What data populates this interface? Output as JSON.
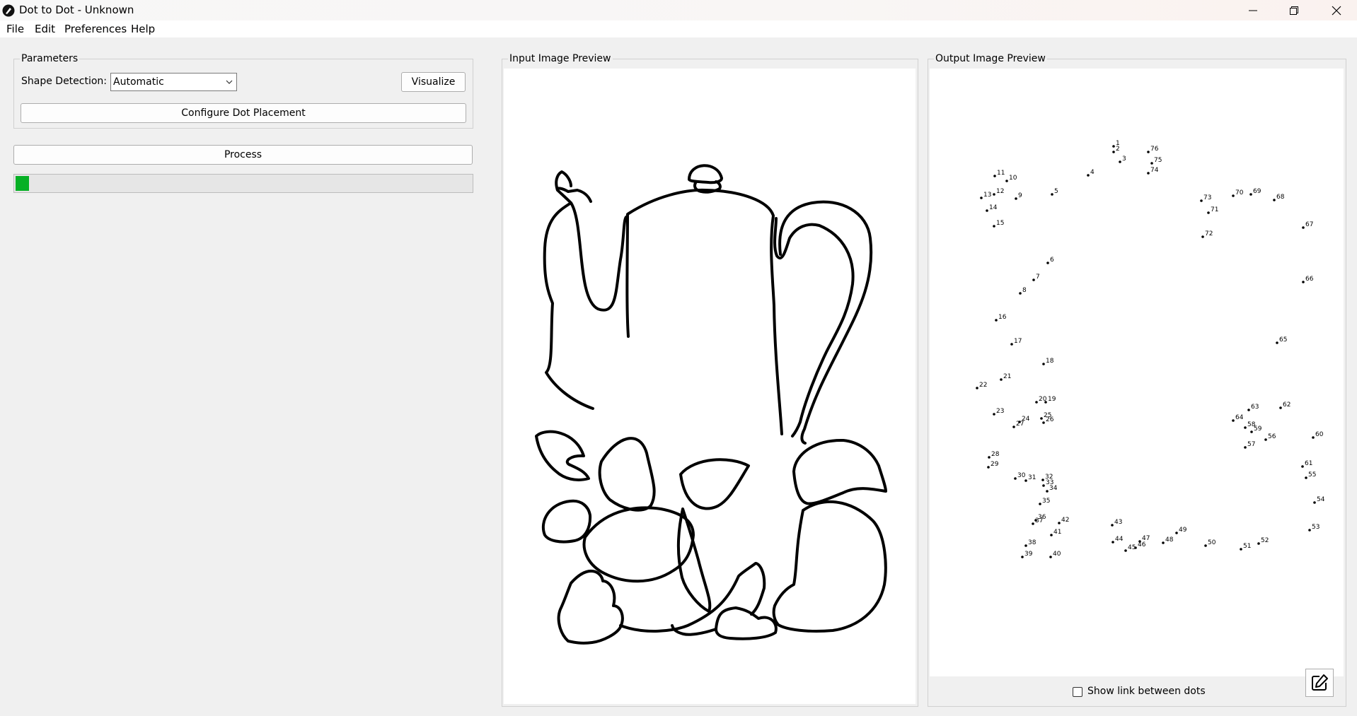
{
  "window": {
    "title": "Dot to Dot - Unknown",
    "app_icon": "pen-nib-icon",
    "controls": [
      "minimize-icon",
      "restore-icon",
      "close-icon"
    ]
  },
  "menu": {
    "items": [
      "File",
      "Edit",
      "Preferences",
      "Help"
    ]
  },
  "parameters": {
    "legend": "Parameters",
    "shape_detection_label": "Shape Detection:",
    "shape_detection_value": "Automatic",
    "visualize_label": "Visualize",
    "configure_label": "Configure Dot Placement"
  },
  "process": {
    "label": "Process",
    "progress_percent": 3,
    "progress_color": "#06b025"
  },
  "input_preview": {
    "legend": "Input Image Preview"
  },
  "output_preview": {
    "legend": "Output Image Preview",
    "show_link_label": "Show link between dots",
    "show_link_checked": false,
    "edit_icon": "edit-pencil-icon",
    "dot_numbers": [
      "1",
      "2",
      "3",
      "4",
      "5",
      "6",
      "7",
      "8",
      "9",
      "10",
      "11",
      "12",
      "13",
      "14",
      "15",
      "16",
      "17",
      "18",
      "19",
      "20",
      "21",
      "22",
      "23",
      "24",
      "25",
      "26",
      "27",
      "28",
      "29",
      "30",
      "31",
      "32",
      "33",
      "34",
      "35",
      "36",
      "37",
      "38",
      "39",
      "40",
      "41",
      "42",
      "43",
      "44",
      "45",
      "46",
      "47",
      "48",
      "49",
      "50",
      "51",
      "52",
      "53",
      "54",
      "55",
      "56",
      "57",
      "58",
      "59",
      "60",
      "61",
      "62",
      "63",
      "64",
      "65",
      "66",
      "67",
      "68",
      "69",
      "70",
      "71",
      "72",
      "73",
      "74",
      "75",
      "76"
    ]
  }
}
